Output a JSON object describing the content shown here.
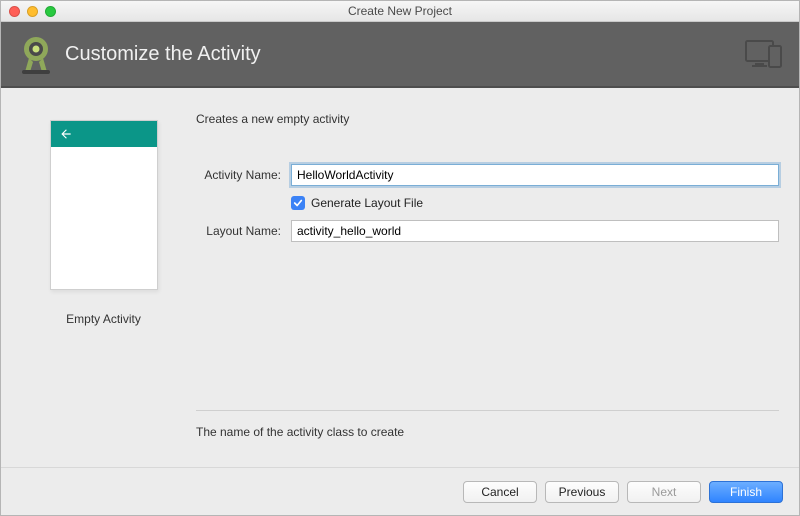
{
  "window": {
    "title": "Create New Project"
  },
  "banner": {
    "heading": "Customize the Activity"
  },
  "preview": {
    "label": "Empty Activity"
  },
  "form": {
    "description": "Creates a new empty activity",
    "activity_name_label": "Activity Name:",
    "activity_name_value": "HelloWorldActivity",
    "generate_layout_label": "Generate Layout File",
    "layout_name_label": "Layout Name:",
    "layout_name_value": "activity_hello_world",
    "help_text": "The name of the activity class to create"
  },
  "buttons": {
    "cancel": "Cancel",
    "previous": "Previous",
    "next": "Next",
    "finish": "Finish"
  }
}
